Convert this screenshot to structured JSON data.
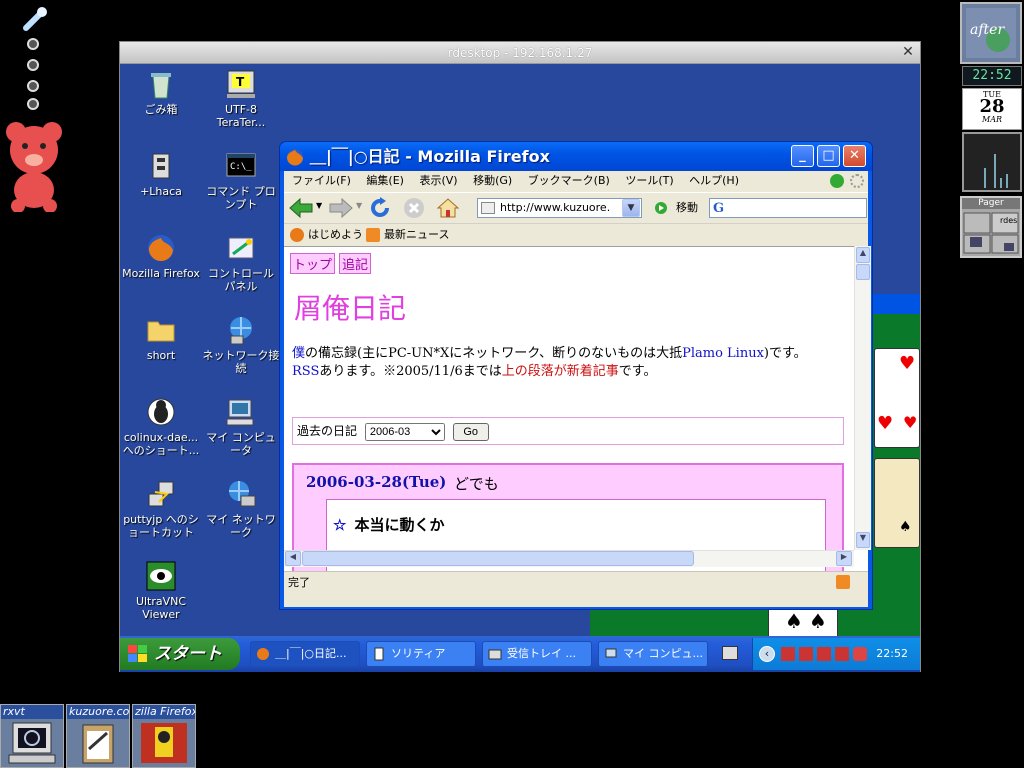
{
  "rdesktop": {
    "title": "rdesktop - 192.168.1.27",
    "close": "✕"
  },
  "right_panel": {
    "clock": "22:52",
    "calendar": {
      "day": "TUE",
      "date": "28",
      "month": "MAR"
    },
    "pager_title": "Pager",
    "pager_label": "rdes"
  },
  "iconbox": [
    {
      "title": "rxvt"
    },
    {
      "title": "kuzuore.com"
    },
    {
      "title": "zilla Firefox"
    }
  ],
  "desktop_icons": [
    {
      "label": "ごみ箱",
      "icon": "recycle-bin-icon"
    },
    {
      "label": "UTF-8 TeraTer...",
      "icon": "teraterm-icon"
    },
    {
      "label": "+Lhaca",
      "icon": "lhaca-icon"
    },
    {
      "label": "コマンド プロンプト",
      "icon": "command-prompt-icon"
    },
    {
      "label": "Mozilla Firefox",
      "icon": "firefox-icon"
    },
    {
      "label": "コントロール パネル",
      "icon": "control-panel-icon"
    },
    {
      "label": "short",
      "icon": "folder-icon"
    },
    {
      "label": "ネットワーク接続",
      "icon": "network-connections-icon"
    },
    {
      "label": "colinux-dae... へのショート...",
      "icon": "colinux-icon"
    },
    {
      "label": "マイ コンピュータ",
      "icon": "my-computer-icon"
    },
    {
      "label": "puttyjp へのショートカット",
      "icon": "putty-icon"
    },
    {
      "label": "マイ ネットワーク",
      "icon": "my-network-icon"
    },
    {
      "label": "UltraVNC Viewer",
      "icon": "ultravnc-icon"
    }
  ],
  "taskbar": {
    "start": "スタート",
    "tasks": [
      {
        "label": "＿|￣|○日記..."
      },
      {
        "label": "ソリティア"
      },
      {
        "label": "受信トレイ ..."
      },
      {
        "label": "マイ コンピュ..."
      }
    ],
    "time": "22:52"
  },
  "firefox": {
    "title": "＿|￣|○日記 - Mozilla Firefox",
    "menu": [
      "ファイル(F)",
      "編集(E)",
      "表示(V)",
      "移動(G)",
      "ブックマーク(B)",
      "ツール(T)",
      "ヘルプ(H)"
    ],
    "url": "http://www.kuzuore.",
    "go": "移動",
    "bookmarks": [
      "はじめよう",
      "最新ニュース"
    ],
    "status": "完了",
    "page": {
      "nav": [
        "トップ",
        "追記"
      ],
      "site_title": "屑俺日記",
      "desc_pre": "僕",
      "desc_mid": "の備忘録(主にPC-UN*Xにネットワーク、断りのないものは大抵",
      "desc_link": "Plamo Linux",
      "desc_post": ")です。",
      "rss_link": "RSS",
      "rss_mid": "あります。※2005/11/6までは",
      "rss_red": "上の段落が新着記事",
      "rss_post": "です。",
      "archive_label": "過去の日記",
      "archive_value": "2006-03",
      "archive_go": "Go",
      "entry_date": "2006-03-28(Tue)",
      "entry_title": "どでも",
      "entry_sub": "本当に動くか"
    }
  }
}
